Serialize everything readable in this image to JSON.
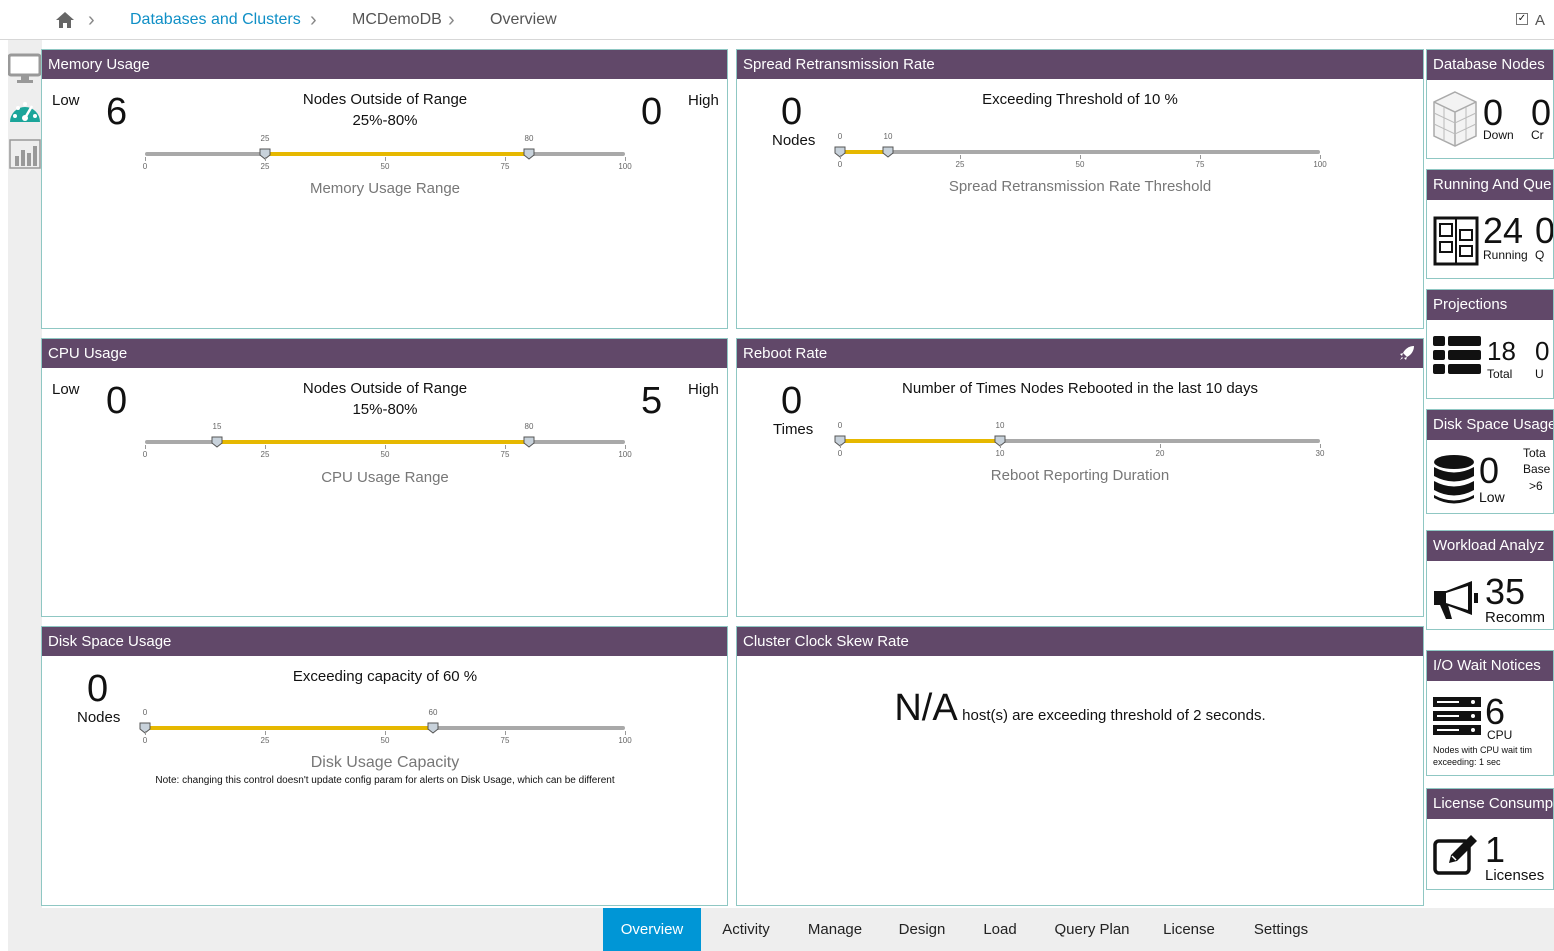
{
  "breadcrumb": {
    "home_icon": "home-icon",
    "items": [
      "Databases and Clusters",
      "MCDemoDB",
      "Overview"
    ],
    "right_checkbox_label": "A"
  },
  "leftnav": {
    "icons": [
      "monitor-icon",
      "dashboard-icon",
      "bar-chart-icon"
    ]
  },
  "panels": {
    "memory": {
      "title": "Memory Usage",
      "low_label": "Low",
      "low_value": "6",
      "high_value": "0",
      "high_label": "High",
      "caption1": "Nodes Outside of Range",
      "caption2": "25%-80%",
      "range_label": "Memory Usage Range",
      "handle_values": [
        "25",
        "80"
      ],
      "ticks": [
        "0",
        "25",
        "50",
        "75",
        "100"
      ],
      "range": {
        "min": 0,
        "max": 100,
        "low": 25,
        "high": 80
      }
    },
    "spread": {
      "title": "Spread Retransmission Rate",
      "value": "0",
      "unit": "Nodes",
      "caption": "Exceeding Threshold of 10 %",
      "range_label": "Spread Retransmission Rate Threshold",
      "handle_values": [
        "0",
        "10"
      ],
      "ticks": [
        "0",
        "25",
        "50",
        "75",
        "100"
      ],
      "range": {
        "min": 0,
        "max": 100,
        "low": 0,
        "high": 10
      }
    },
    "cpu": {
      "title": "CPU Usage",
      "low_label": "Low",
      "low_value": "0",
      "high_value": "5",
      "high_label": "High",
      "caption1": "Nodes Outside of Range",
      "caption2": "15%-80%",
      "range_label": "CPU Usage Range",
      "handle_values": [
        "15",
        "80"
      ],
      "ticks": [
        "0",
        "25",
        "50",
        "75",
        "100"
      ],
      "range": {
        "min": 0,
        "max": 100,
        "low": 15,
        "high": 80
      }
    },
    "reboot": {
      "title": "Reboot Rate",
      "icon": "rocket-icon",
      "value": "0",
      "unit": "Times",
      "caption": "Number of Times Nodes Rebooted in the last 10 days",
      "range_label": "Reboot Reporting Duration",
      "handle_values": [
        "0",
        "10"
      ],
      "ticks": [
        "0",
        "10",
        "20",
        "30"
      ],
      "range": {
        "min": 0,
        "max": 30,
        "low": 0,
        "high": 10
      }
    },
    "disk": {
      "title": "Disk Space Usage",
      "value": "0",
      "unit": "Nodes",
      "caption": "Exceeding capacity of 60 %",
      "range_label": "Disk Usage Capacity",
      "note": "Note: changing this control doesn't update config param for alerts on Disk Usage, which can be different",
      "handle_values": [
        "0",
        "60"
      ],
      "ticks": [
        "0",
        "25",
        "50",
        "75",
        "100"
      ],
      "range": {
        "min": 0,
        "max": 100,
        "low": 0,
        "high": 60
      }
    },
    "clock": {
      "title": "Cluster Clock Skew Rate",
      "value": "N/A",
      "text": "host(s) are exceeding threshold of 2 seconds."
    }
  },
  "side": {
    "nodes": {
      "title": "Database Nodes",
      "icon": "cube-icon",
      "v1": "0",
      "l1": "Down",
      "v2": "0",
      "l2": "Cr"
    },
    "running": {
      "title": "Running And Que",
      "icon": "queue-icon",
      "v1": "24",
      "l1": "Running",
      "v2": "0",
      "l2": "Q"
    },
    "projections": {
      "title": "Projections",
      "icon": "list-icon",
      "v1": "18",
      "l1": "Total",
      "v2": "0",
      "l2": "U"
    },
    "disk": {
      "title": "Disk Space Usage",
      "icon": "database-icon",
      "v1": "0",
      "l1": "Low",
      "t1": "Tota",
      "t2": "Base",
      "t3": ">6"
    },
    "workload": {
      "title": "Workload Analyz",
      "icon": "megaphone-icon",
      "v1": "35",
      "l1": "Recomm"
    },
    "iowait": {
      "title": "I/O Wait Notices",
      "icon": "server-icon",
      "v1": "6",
      "l1": "CPU",
      "note1": "Nodes with CPU wait tim",
      "note2": "exceeding: 1 sec"
    },
    "license": {
      "title": "License Consump",
      "icon": "edit-icon",
      "v1": "1",
      "l1": "Licenses"
    }
  },
  "tabs": [
    "Overview",
    "Activity",
    "Manage",
    "Design",
    "Load",
    "Query Plan",
    "License",
    "Settings"
  ],
  "colors": {
    "header": "#614869",
    "accent": "#0096d6",
    "slider_fill": "#e6b800",
    "panel_border": "#8fc7c3"
  }
}
